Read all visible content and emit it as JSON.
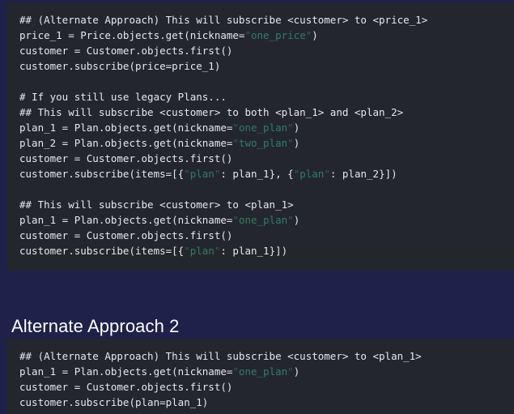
{
  "theme": {
    "page_background": "#1e2149",
    "code_background": "#24262e",
    "code_text": "#e8e8ea",
    "string_color": "#2f7f63",
    "quote_color": "#33604f",
    "heading_color": "#ffffff"
  },
  "blocks": {
    "code_block_1": {
      "language": "python",
      "lines": [
        "## (Alternate Approach) This will subscribe <customer> to <price_1>",
        "price_1 = Price.objects.get(nickname=\"one_price\")",
        "customer = Customer.objects.first()",
        "customer.subscribe(price=price_1)",
        "",
        "# If you still use legacy Plans...",
        "## This will subscribe <customer> to both <plan_1> and <plan_2>",
        "plan_1 = Plan.objects.get(nickname=\"one_plan\")",
        "plan_2 = Plan.objects.get(nickname=\"two_plan\")",
        "customer = Customer.objects.first()",
        "customer.subscribe(items=[{\"plan\": plan_1}, {\"plan\": plan_2}])",
        "",
        "## This will subscribe <customer> to <plan_1>",
        "plan_1 = Plan.objects.get(nickname=\"one_plan\")",
        "customer = Customer.objects.first()",
        "customer.subscribe(items=[{\"plan\": plan_1}])"
      ]
    },
    "heading": {
      "text": "Alternate Approach 2"
    },
    "code_block_2": {
      "language": "python",
      "lines": [
        "## (Alternate Approach) This will subscribe <customer> to <plan_1>",
        "plan_1 = Plan.objects.get(nickname=\"one_plan\")",
        "customer = Customer.objects.first()",
        "customer.subscribe(plan=plan_1)"
      ]
    }
  }
}
